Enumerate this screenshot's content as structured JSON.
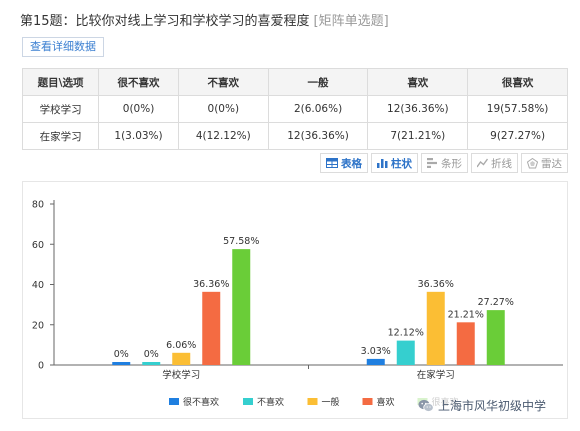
{
  "question": {
    "title": "第15题：比较你对线上学习和学校学习的喜爱程度",
    "type": "[矩阵单选题]"
  },
  "detail_button": "查看详细数据",
  "table": {
    "headers": [
      "题目\\选项",
      "很不喜欢",
      "不喜欢",
      "一般",
      "喜欢",
      "很喜欢"
    ],
    "rows": [
      [
        "学校学习",
        "0(0%)",
        "0(0%)",
        "2(6.06%)",
        "12(36.36%)",
        "19(57.58%)"
      ],
      [
        "在家学习",
        "1(3.03%)",
        "4(12.12%)",
        "12(36.36%)",
        "7(21.21%)",
        "9(27.27%)"
      ]
    ]
  },
  "view_tabs": [
    {
      "label": "表格",
      "icon": "table-icon",
      "active": true
    },
    {
      "label": "柱状",
      "icon": "bar-chart-icon",
      "active": true
    },
    {
      "label": "条形",
      "icon": "hbar-chart-icon",
      "active": false
    },
    {
      "label": "折线",
      "icon": "line-chart-icon",
      "active": false
    },
    {
      "label": "雷达",
      "icon": "radar-chart-icon",
      "active": false
    }
  ],
  "chart_data": {
    "type": "bar",
    "categories": [
      "学校学习",
      "在家学习"
    ],
    "series": [
      {
        "name": "很不喜欢",
        "color": "#1f7fe0",
        "values": [
          0,
          3.03
        ],
        "labels": [
          "0%",
          "3.03%"
        ]
      },
      {
        "name": "不喜欢",
        "color": "#35cfcf",
        "values": [
          0,
          12.12
        ],
        "labels": [
          "0%",
          "12.12%"
        ]
      },
      {
        "name": "一般",
        "color": "#fbbe34",
        "values": [
          6.06,
          36.36
        ],
        "labels": [
          "6.06%",
          "36.36%"
        ]
      },
      {
        "name": "喜欢",
        "color": "#f46b42",
        "values": [
          36.36,
          21.21
        ],
        "labels": [
          "36.36%",
          "21.21%"
        ]
      },
      {
        "name": "很喜欢",
        "color": "#6acd38",
        "values": [
          57.58,
          27.27
        ],
        "labels": [
          "57.58%",
          "27.27%"
        ]
      }
    ],
    "ylim": [
      0,
      80
    ],
    "yticks": [
      0,
      20,
      40,
      60,
      80
    ],
    "legend": "bottom",
    "grid": false
  },
  "watermark": "上海市风华初级中学"
}
